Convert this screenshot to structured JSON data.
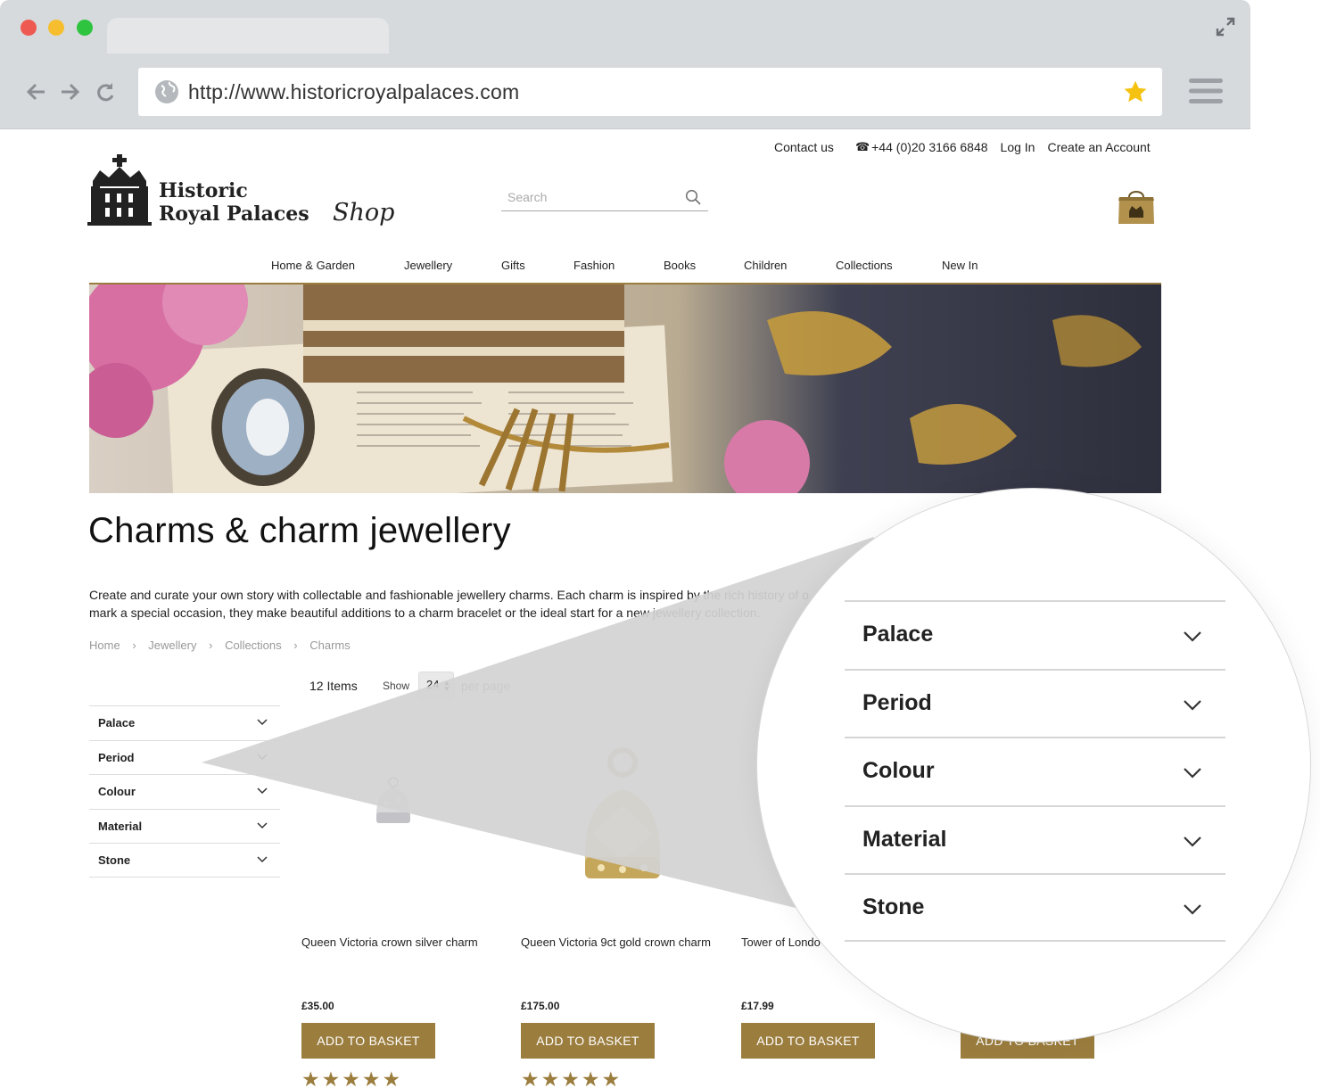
{
  "browser": {
    "url": "http://www.historicroyalpalaces.com",
    "traffic_lights": [
      "#ee5a52",
      "#f6be2f",
      "#2fc440"
    ]
  },
  "header": {
    "contact": "Contact us",
    "phone": "+44 (0)20 3166 6848",
    "login": "Log In",
    "create_account": "Create an Account",
    "logo_line1": "Historic",
    "logo_line2": "Royal Palaces",
    "logo_shop": "Shop",
    "search_placeholder": "Search"
  },
  "nav": [
    "Home & Garden",
    "Jewellery",
    "Gifts",
    "Fashion",
    "Books",
    "Children",
    "Collections",
    "New In"
  ],
  "page": {
    "title": "Charms & charm jewellery",
    "intro": "Create and curate your own story with collectable and fashionable jewellery charms. Each charm is inspired by the rich history of o",
    "intro_line2": "mark a special occasion, they make beautiful additions to a charm bracelet or the ideal start for a new jewellery collection.",
    "breadcrumb": [
      "Home",
      "Jewellery",
      "Collections",
      "Charms"
    ],
    "breadcrumb_sep": "›",
    "items_count": "12 Items",
    "show_label": "Show",
    "per_page_value": "24",
    "per_page_label": "per page"
  },
  "filters": [
    "Palace",
    "Period",
    "Colour",
    "Material",
    "Stone"
  ],
  "products": [
    {
      "name": "Queen Victoria crown silver charm",
      "price": "£35.00",
      "button": "ADD TO BASKET",
      "stars": "★★★★★"
    },
    {
      "name": "Queen Victoria 9ct gold crown charm",
      "price": "£175.00",
      "button": "ADD TO BASKET",
      "stars": "★★★★★"
    },
    {
      "name": "Tower of Londo",
      "price": "£17.99",
      "button": "ADD TO BASKET",
      "stars": ""
    },
    {
      "name": "",
      "price": "",
      "button": "ADD TO BASKET",
      "stars": ""
    }
  ],
  "magnifier": {
    "filters": [
      "Palace",
      "Period",
      "Colour",
      "Material",
      "Stone"
    ]
  },
  "colors": {
    "accent_gold": "#9b7d3e",
    "chrome_gray": "#d7dadd",
    "bookmark_star": "#f5c211"
  }
}
